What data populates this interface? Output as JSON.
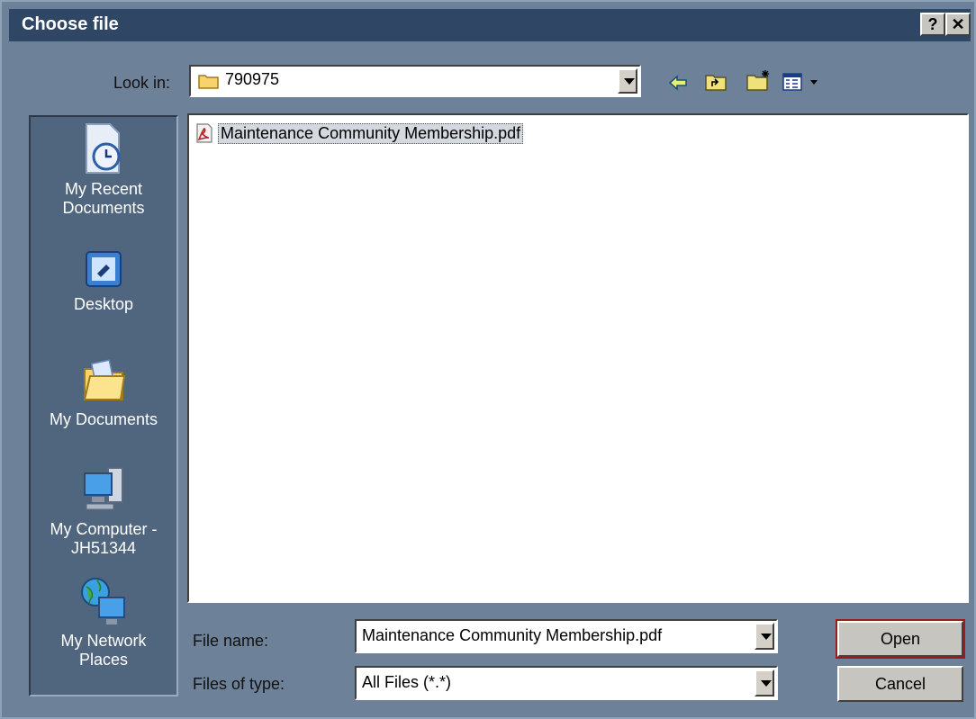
{
  "window": {
    "title": "Choose file",
    "help_button": "?",
    "close_button": "✕"
  },
  "look_in": {
    "label": "Look in:",
    "value": "790975"
  },
  "toolbar": {
    "back_icon": "back-arrow-icon",
    "up_icon": "up-folder-icon",
    "new_folder_icon": "new-folder-icon",
    "view_menu_icon": "view-menu-icon"
  },
  "places": [
    {
      "line1": "My Recent",
      "line2": "Documents",
      "icon": "recent-documents-icon"
    },
    {
      "line1": "Desktop",
      "line2": "",
      "icon": "desktop-icon"
    },
    {
      "line1": "My Documents",
      "line2": "",
      "icon": "my-documents-icon"
    },
    {
      "line1": "My Computer -",
      "line2": "JH51344",
      "icon": "my-computer-icon"
    },
    {
      "line1": "My Network",
      "line2": "Places",
      "icon": "network-places-icon"
    }
  ],
  "files": [
    {
      "name": "Maintenance Community Membership.pdf",
      "icon": "pdf-file-icon"
    }
  ],
  "file_name": {
    "label": "File name:",
    "value": "Maintenance Community Membership.pdf"
  },
  "file_type": {
    "label": "Files of type:",
    "value": "All Files (*.*)"
  },
  "buttons": {
    "open": "Open",
    "cancel": "Cancel"
  }
}
